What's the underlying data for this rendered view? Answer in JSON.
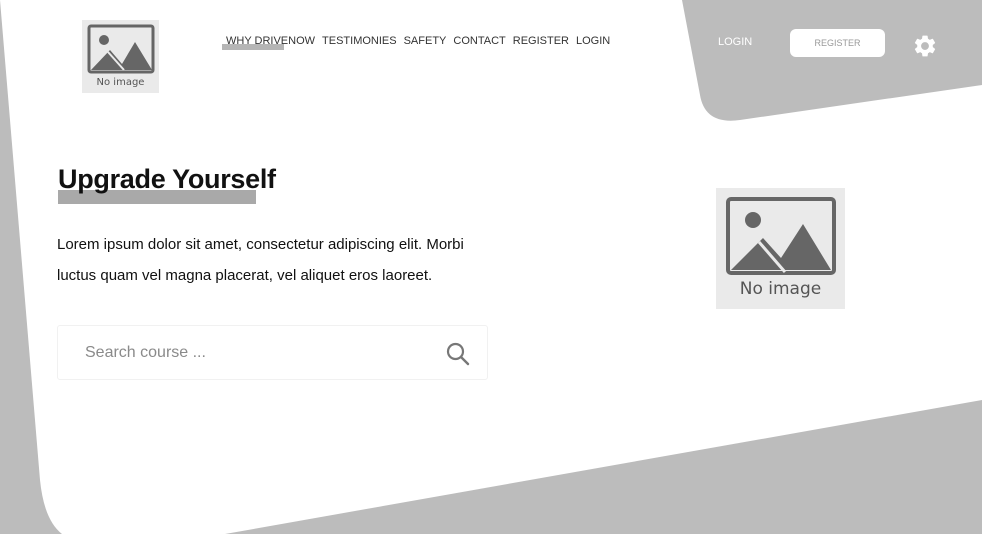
{
  "header": {
    "logo_text": "No image",
    "nav_items": [
      {
        "label": "WHY DRIVENOW"
      },
      {
        "label": "TESTIMONIES"
      },
      {
        "label": "SAFETY"
      },
      {
        "label": "CONTACT"
      },
      {
        "label": "REGISTER"
      },
      {
        "label": "LOGIN"
      }
    ],
    "login_label": "LOGIN",
    "register_label": "REGISTER",
    "settings_icon": "gear-icon"
  },
  "hero": {
    "title": "Upgrade Yourself",
    "description": "Lorem ipsum dolor sit amet, consectetur adipiscing elit. Morbi luctus quam vel magna placerat, vel aliquet eros laoreet.",
    "image_text": "No image"
  },
  "search": {
    "placeholder": "Search course ...",
    "value": "",
    "icon": "search-icon"
  },
  "colors": {
    "background": "#ffffff",
    "shape_gray": "#bcbcbc",
    "placeholder_bg": "#eaeaea",
    "placeholder_fg": "#666666"
  }
}
